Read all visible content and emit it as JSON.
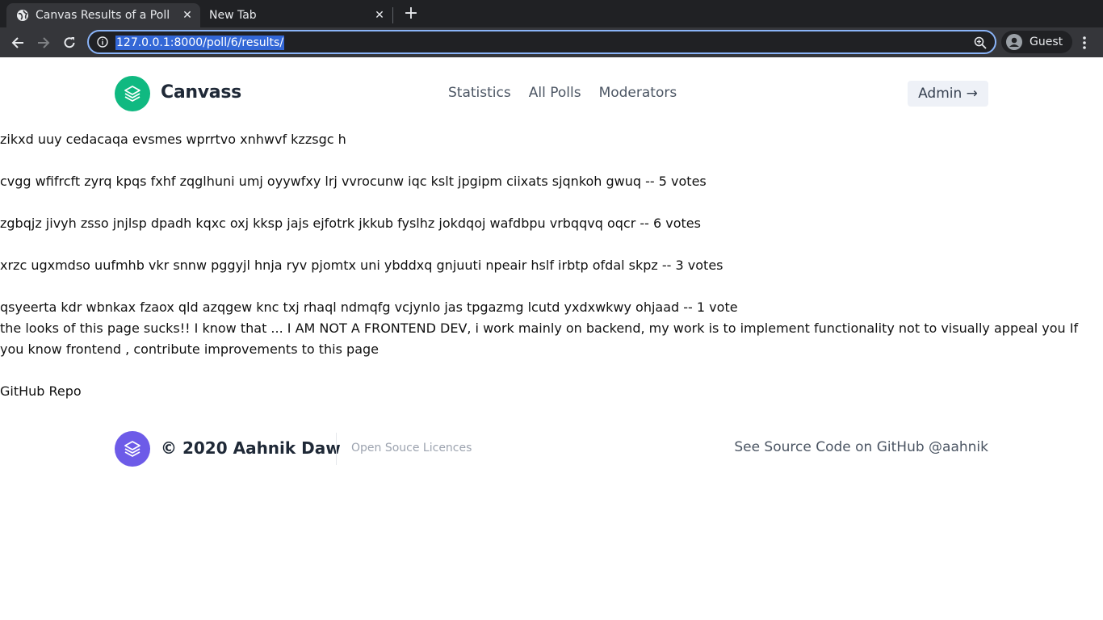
{
  "browser": {
    "tabs": [
      {
        "title": "Canvas Results of a Poll",
        "active": true
      },
      {
        "title": "New Tab",
        "active": false
      }
    ],
    "url": "127.0.0.1:8000/poll/6/results/",
    "profile_name": "Guest"
  },
  "header": {
    "brand": "Canvass",
    "nav": [
      "Statistics",
      "All Polls",
      "Moderators"
    ],
    "admin_label": "Admin →"
  },
  "poll": {
    "question": "zikxd uuy cedacaqa evsmes wprrtvo xnhwvf kzzsgc h",
    "options": [
      "cvgg wfifrcft zyrq kpqs fxhf zqglhuni umj oyywfxy lrj vvrocunw iqc kslt jpgipm ciixats sjqnkoh gwuq -- 5 votes",
      "zgbqjz jivyh zsso jnjlsp dpadh kqxc oxj kksp jajs ejfotrk jkkub fyslhz jokdqoj wafdbpu vrbqqvq oqcr -- 6 votes",
      "xrzc ugxmdso uufmhb vkr snnw pggyjl hnja ryv pjomtx uni ybddxq gnjuuti npeair hslf irbtp ofdal skpz -- 3 votes",
      "qsyeerta kdr wbnkax fzaox qld azqgew knc txj rhaql ndmqfg vcjynlo jas tpgazmg lcutd yxdxwkwy ohjaad -- 1 vote"
    ]
  },
  "note": "the looks of this page sucks!! I know that ... I AM NOT A FRONTEND DEV, i work mainly on backend, my work is to implement functionality not to visually appeal you If you know frontend , contribute improvements to this page",
  "repo_link": "GitHub Repo",
  "footer": {
    "copyright": "© 2020 Aahnik Daw",
    "licences": "Open Souce Licences",
    "source": "See Source Code on GitHub @aahnik"
  },
  "colors": {
    "header_logo": "#10b981",
    "footer_logo": "#6d5be8",
    "omnibox_focus": "#8ab4f8"
  }
}
